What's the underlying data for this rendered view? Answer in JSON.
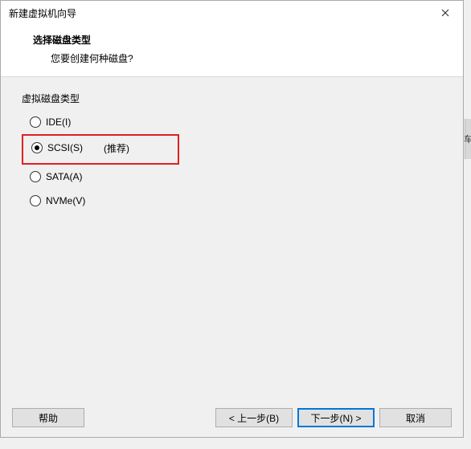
{
  "titleBar": {
    "title": "新建虚拟机向导"
  },
  "header": {
    "title": "选择磁盘类型",
    "subtitle": "您要创建何种磁盘?"
  },
  "group": {
    "label": "虚拟磁盘类型"
  },
  "options": {
    "ide": {
      "label": "IDE(I)"
    },
    "scsi": {
      "label": "SCSI(S)",
      "extra": "(推荐)"
    },
    "sata": {
      "label": "SATA(A)"
    },
    "nvme": {
      "label": "NVMe(V)"
    }
  },
  "buttons": {
    "help": "帮助",
    "back": "< 上一步(B)",
    "next": "下一步(N) >",
    "cancel": "取消"
  },
  "sideFragment": "车"
}
